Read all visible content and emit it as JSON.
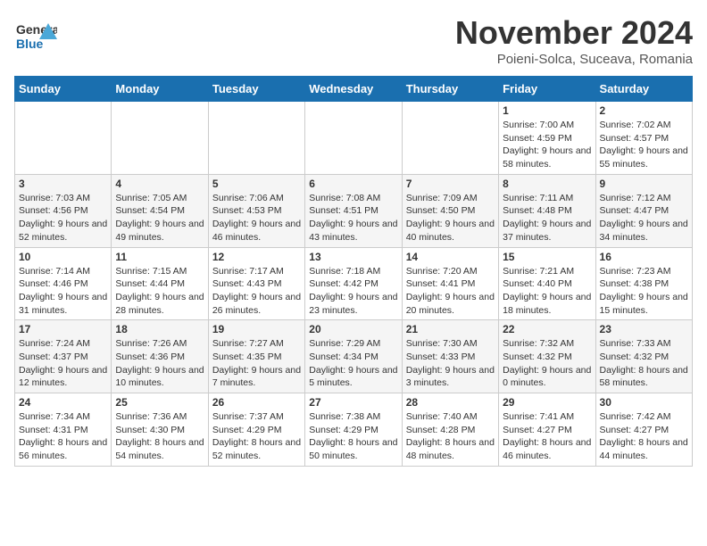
{
  "header": {
    "logo_line1": "General",
    "logo_line2": "Blue",
    "month_title": "November 2024",
    "location": "Poieni-Solca, Suceava, Romania"
  },
  "weekdays": [
    "Sunday",
    "Monday",
    "Tuesday",
    "Wednesday",
    "Thursday",
    "Friday",
    "Saturday"
  ],
  "weeks": [
    [
      {
        "day": "",
        "info": ""
      },
      {
        "day": "",
        "info": ""
      },
      {
        "day": "",
        "info": ""
      },
      {
        "day": "",
        "info": ""
      },
      {
        "day": "",
        "info": ""
      },
      {
        "day": "1",
        "info": "Sunrise: 7:00 AM\nSunset: 4:59 PM\nDaylight: 9 hours and 58 minutes."
      },
      {
        "day": "2",
        "info": "Sunrise: 7:02 AM\nSunset: 4:57 PM\nDaylight: 9 hours and 55 minutes."
      }
    ],
    [
      {
        "day": "3",
        "info": "Sunrise: 7:03 AM\nSunset: 4:56 PM\nDaylight: 9 hours and 52 minutes."
      },
      {
        "day": "4",
        "info": "Sunrise: 7:05 AM\nSunset: 4:54 PM\nDaylight: 9 hours and 49 minutes."
      },
      {
        "day": "5",
        "info": "Sunrise: 7:06 AM\nSunset: 4:53 PM\nDaylight: 9 hours and 46 minutes."
      },
      {
        "day": "6",
        "info": "Sunrise: 7:08 AM\nSunset: 4:51 PM\nDaylight: 9 hours and 43 minutes."
      },
      {
        "day": "7",
        "info": "Sunrise: 7:09 AM\nSunset: 4:50 PM\nDaylight: 9 hours and 40 minutes."
      },
      {
        "day": "8",
        "info": "Sunrise: 7:11 AM\nSunset: 4:48 PM\nDaylight: 9 hours and 37 minutes."
      },
      {
        "day": "9",
        "info": "Sunrise: 7:12 AM\nSunset: 4:47 PM\nDaylight: 9 hours and 34 minutes."
      }
    ],
    [
      {
        "day": "10",
        "info": "Sunrise: 7:14 AM\nSunset: 4:46 PM\nDaylight: 9 hours and 31 minutes."
      },
      {
        "day": "11",
        "info": "Sunrise: 7:15 AM\nSunset: 4:44 PM\nDaylight: 9 hours and 28 minutes."
      },
      {
        "day": "12",
        "info": "Sunrise: 7:17 AM\nSunset: 4:43 PM\nDaylight: 9 hours and 26 minutes."
      },
      {
        "day": "13",
        "info": "Sunrise: 7:18 AM\nSunset: 4:42 PM\nDaylight: 9 hours and 23 minutes."
      },
      {
        "day": "14",
        "info": "Sunrise: 7:20 AM\nSunset: 4:41 PM\nDaylight: 9 hours and 20 minutes."
      },
      {
        "day": "15",
        "info": "Sunrise: 7:21 AM\nSunset: 4:40 PM\nDaylight: 9 hours and 18 minutes."
      },
      {
        "day": "16",
        "info": "Sunrise: 7:23 AM\nSunset: 4:38 PM\nDaylight: 9 hours and 15 minutes."
      }
    ],
    [
      {
        "day": "17",
        "info": "Sunrise: 7:24 AM\nSunset: 4:37 PM\nDaylight: 9 hours and 12 minutes."
      },
      {
        "day": "18",
        "info": "Sunrise: 7:26 AM\nSunset: 4:36 PM\nDaylight: 9 hours and 10 minutes."
      },
      {
        "day": "19",
        "info": "Sunrise: 7:27 AM\nSunset: 4:35 PM\nDaylight: 9 hours and 7 minutes."
      },
      {
        "day": "20",
        "info": "Sunrise: 7:29 AM\nSunset: 4:34 PM\nDaylight: 9 hours and 5 minutes."
      },
      {
        "day": "21",
        "info": "Sunrise: 7:30 AM\nSunset: 4:33 PM\nDaylight: 9 hours and 3 minutes."
      },
      {
        "day": "22",
        "info": "Sunrise: 7:32 AM\nSunset: 4:32 PM\nDaylight: 9 hours and 0 minutes."
      },
      {
        "day": "23",
        "info": "Sunrise: 7:33 AM\nSunset: 4:32 PM\nDaylight: 8 hours and 58 minutes."
      }
    ],
    [
      {
        "day": "24",
        "info": "Sunrise: 7:34 AM\nSunset: 4:31 PM\nDaylight: 8 hours and 56 minutes."
      },
      {
        "day": "25",
        "info": "Sunrise: 7:36 AM\nSunset: 4:30 PM\nDaylight: 8 hours and 54 minutes."
      },
      {
        "day": "26",
        "info": "Sunrise: 7:37 AM\nSunset: 4:29 PM\nDaylight: 8 hours and 52 minutes."
      },
      {
        "day": "27",
        "info": "Sunrise: 7:38 AM\nSunset: 4:29 PM\nDaylight: 8 hours and 50 minutes."
      },
      {
        "day": "28",
        "info": "Sunrise: 7:40 AM\nSunset: 4:28 PM\nDaylight: 8 hours and 48 minutes."
      },
      {
        "day": "29",
        "info": "Sunrise: 7:41 AM\nSunset: 4:27 PM\nDaylight: 8 hours and 46 minutes."
      },
      {
        "day": "30",
        "info": "Sunrise: 7:42 AM\nSunset: 4:27 PM\nDaylight: 8 hours and 44 minutes."
      }
    ]
  ]
}
